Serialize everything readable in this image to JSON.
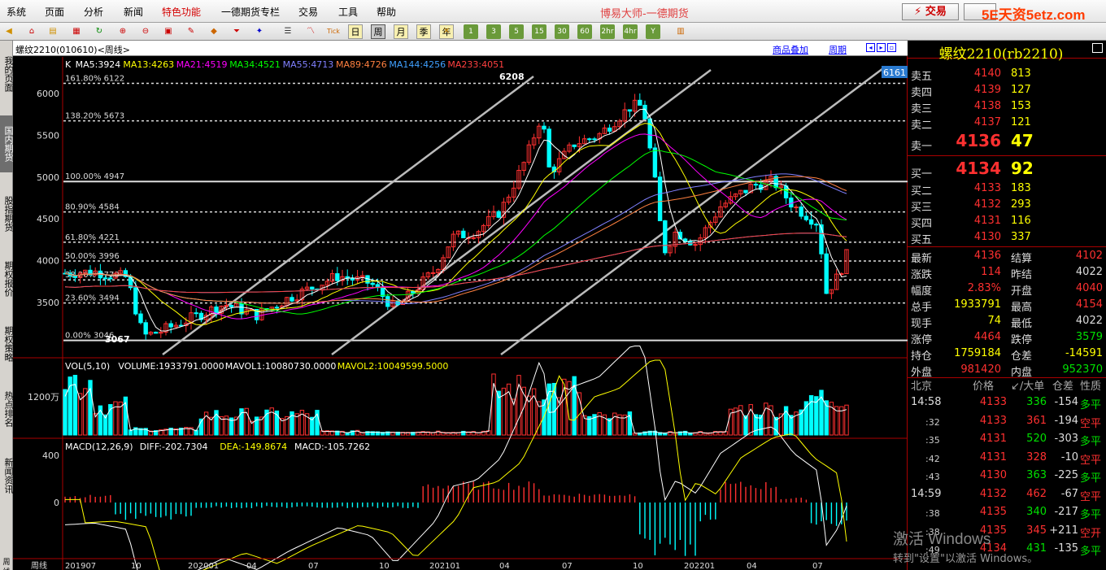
{
  "menu": {
    "items": [
      "系统",
      "页面",
      "分析",
      "新闻",
      "特色功能",
      "一德期货专栏",
      "交易",
      "工具",
      "帮助"
    ],
    "special_index": 4,
    "app_title": "博易大师-一德期货",
    "trade_button": "⚡ 交易",
    "watermark_logo": "5E天资5etz.com"
  },
  "toolbar": {
    "periods": [
      "日",
      "周",
      "月",
      "季",
      "年"
    ],
    "active_period": "周",
    "minute_buttons": [
      "1",
      "3",
      "5",
      "15",
      "30",
      "60",
      "2hr",
      "4hr",
      "Y"
    ]
  },
  "left_tabs": [
    {
      "label": "我的页面",
      "active": false
    },
    {
      "label": "国内期货",
      "active": true
    },
    {
      "label": "股指期货",
      "active": false
    },
    {
      "label": "期权报价",
      "active": false
    },
    {
      "label": "期权策略",
      "active": false
    },
    {
      "label": "热点排名",
      "active": false
    },
    {
      "label": "新闻资讯",
      "active": false
    },
    {
      "label": "周线",
      "active": false
    }
  ],
  "chart_header": {
    "symbol": "螺纹2210(010610)<周线>",
    "overlay_link": "商品叠加",
    "period_link": "周期"
  },
  "price_panel": {
    "ma_legend": [
      {
        "text": "K",
        "color": "#ffffff"
      },
      {
        "text": "MA5:3924",
        "color": "#ffffff"
      },
      {
        "text": "MA13:4263",
        "color": "#ffff00"
      },
      {
        "text": "MA21:4519",
        "color": "#ff00ff"
      },
      {
        "text": "MA34:4521",
        "color": "#00ff00"
      },
      {
        "text": "MA55:4713",
        "color": "#8080ff"
      },
      {
        "text": "MA89:4726",
        "color": "#ff8040"
      },
      {
        "text": "MA144:4256",
        "color": "#40a0ff"
      },
      {
        "text": "MA233:4051",
        "color": "#ff4040"
      }
    ],
    "y_ticks": [
      "6000",
      "5500",
      "5000",
      "4500",
      "4000",
      "3500"
    ],
    "fib_levels": [
      {
        "label": "161.80% 6122",
        "price": 6122,
        "solid": false
      },
      {
        "label": "138.20% 5673",
        "price": 5673,
        "solid": false
      },
      {
        "label": "100.00% 4947",
        "price": 4947,
        "solid": true
      },
      {
        "label": "80.90% 4584",
        "price": 4584,
        "solid": false
      },
      {
        "label": "61.80% 4221",
        "price": 4221,
        "solid": false
      },
      {
        "label": "50.00% 3996",
        "price": 3996,
        "solid": false
      },
      {
        "label": "38.20% 3770",
        "price": 3770,
        "solid": false
      },
      {
        "label": "23.60% 3494",
        "price": 3494,
        "solid": false
      },
      {
        "label": "0.00% 3046",
        "price": 3046,
        "solid": true
      }
    ],
    "high_label": "6208",
    "low_label": "3067",
    "last_price_tag": "6161"
  },
  "volume_panel": {
    "legend": [
      {
        "text": "VOL(5,10)",
        "color": "#ffffff"
      },
      {
        "text": "VOLUME:1933791.0000",
        "color": "#ffffff"
      },
      {
        "text": "MAVOL1:10080730.0000",
        "color": "#ffffff"
      },
      {
        "text": "MAVOL2:10049599.5000",
        "color": "#ffff00"
      }
    ],
    "y_tick": "1200万"
  },
  "macd_panel": {
    "legend": [
      {
        "text": "MACD(12,26,9)",
        "color": "#ffffff"
      },
      {
        "text": "DIFF:-202.7304",
        "color": "#ffffff"
      },
      {
        "text": "DEA:-149.8674",
        "color": "#ffff00"
      },
      {
        "text": "MACD:-105.7262",
        "color": "#ffffff"
      }
    ],
    "y_ticks": [
      "400",
      "0"
    ]
  },
  "x_axis": [
    "周线",
    "201907",
    "10",
    "202001",
    "04",
    "07",
    "10",
    "202101",
    "04",
    "07",
    "10",
    "202201",
    "04",
    "07"
  ],
  "quote": {
    "title": "螺纹2210(rb2210)",
    "asks": [
      {
        "label": "卖五",
        "price": "4140",
        "vol": "813"
      },
      {
        "label": "卖四",
        "price": "4139",
        "vol": "127"
      },
      {
        "label": "卖三",
        "price": "4138",
        "vol": "153"
      },
      {
        "label": "卖二",
        "price": "4137",
        "vol": "121"
      },
      {
        "label": "卖一",
        "price": "4136",
        "vol": "47"
      }
    ],
    "bids": [
      {
        "label": "买一",
        "price": "4134",
        "vol": "92"
      },
      {
        "label": "买二",
        "price": "4133",
        "vol": "183"
      },
      {
        "label": "买三",
        "price": "4132",
        "vol": "293"
      },
      {
        "label": "买四",
        "price": "4131",
        "vol": "116"
      },
      {
        "label": "买五",
        "price": "4130",
        "vol": "337"
      }
    ],
    "stats": [
      {
        "l": "最新",
        "lv": "4136",
        "lc": "red",
        "r": "结算",
        "rv": "4102",
        "rc": "red"
      },
      {
        "l": "涨跌",
        "lv": "114",
        "lc": "red",
        "r": "昨结",
        "rv": "4022",
        "rc": "white"
      },
      {
        "l": "幅度",
        "lv": "2.83%",
        "lc": "red",
        "r": "开盘",
        "rv": "4040",
        "rc": "red"
      },
      {
        "l": "总手",
        "lv": "1933791",
        "lc": "yellow",
        "r": "最高",
        "rv": "4154",
        "rc": "red"
      },
      {
        "l": "现手",
        "lv": "74",
        "lc": "yellow",
        "r": "最低",
        "rv": "4022",
        "rc": "white"
      },
      {
        "l": "涨停",
        "lv": "4464",
        "lc": "red",
        "r": "跌停",
        "rv": "3579",
        "rc": "green"
      },
      {
        "l": "持仓",
        "lv": "1759184",
        "lc": "yellow",
        "r": "仓差",
        "rv": "-14591",
        "rc": "yellow"
      },
      {
        "l": "外盘",
        "lv": "981420",
        "lc": "red",
        "r": "内盘",
        "rv": "952370",
        "rc": "green"
      }
    ],
    "ticks_header": {
      "time": "北京",
      "price": "价格",
      "vol": "↙/大单",
      "oi": "仓差",
      "nature": "性质"
    },
    "ticks": [
      {
        "time": "14:58",
        "sub": false,
        "price": "4133",
        "vol": "336",
        "oi": "-154",
        "nature": "多平",
        "green": true
      },
      {
        "time": ":32",
        "sub": true,
        "price": "4133",
        "vol": "361",
        "oi": "-194",
        "nature": "空平",
        "green": false
      },
      {
        "time": ":35",
        "sub": true,
        "price": "4131",
        "vol": "520",
        "oi": "-303",
        "nature": "多平",
        "green": true
      },
      {
        "time": ":42",
        "sub": true,
        "price": "4131",
        "vol": "328",
        "oi": "-10",
        "nature": "空平",
        "green": false
      },
      {
        "time": ":43",
        "sub": true,
        "price": "4130",
        "vol": "363",
        "oi": "-225",
        "nature": "多平",
        "green": true
      },
      {
        "time": "14:59",
        "sub": false,
        "price": "4132",
        "vol": "462",
        "oi": "-67",
        "nature": "空平",
        "green": false
      },
      {
        "time": ":38",
        "sub": true,
        "price": "4135",
        "vol": "340",
        "oi": "-217",
        "nature": "多平",
        "green": true
      },
      {
        "time": ":38",
        "sub": true,
        "price": "4135",
        "vol": "345",
        "oi": "+211",
        "nature": "空开",
        "green": false
      },
      {
        "time": ":49",
        "sub": true,
        "price": "4134",
        "vol": "431",
        "oi": "-135",
        "nature": "多平",
        "green": true
      }
    ]
  },
  "os_overlay": {
    "line1": "激活 Windows",
    "line2": "转到\"设置\"以激活 Windows。"
  }
}
